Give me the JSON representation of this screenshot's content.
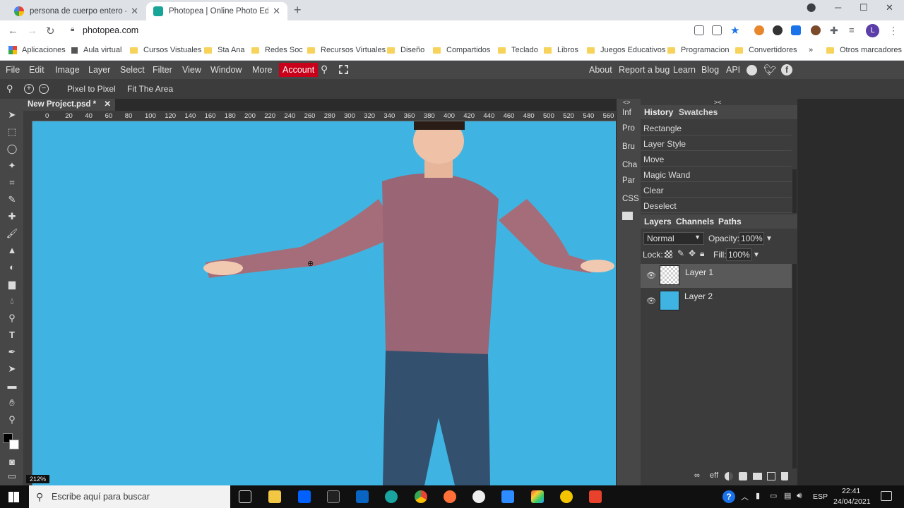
{
  "browser": {
    "tabs": [
      {
        "title": "persona de cuerpo entero - Búsq",
        "active": false
      },
      {
        "title": "Photopea | Online Photo Editor",
        "active": true
      }
    ],
    "url": "photopea.com",
    "avatar_letter": "L",
    "bookmarks": [
      "Aplicaciones",
      "Aula virtual",
      "Cursos Vistuales",
      "Sta Ana",
      "Redes Soc",
      "Recursos Virtuales",
      "Diseño",
      "Compartidos",
      "Teclado",
      "Libros",
      "Juegos Educativos",
      "Programacion",
      "Convertidores"
    ],
    "bookmarks_more": "»",
    "other_bookmarks": "Otros marcadores"
  },
  "menu": {
    "items": [
      "File",
      "Edit",
      "Image",
      "Layer",
      "Select",
      "Filter",
      "View",
      "Window",
      "More"
    ],
    "account": "Account",
    "right_links": [
      "About",
      "Report a bug",
      "Learn",
      "Blog",
      "API"
    ]
  },
  "options": {
    "pixel_to_pixel": "Pixel to Pixel",
    "fit_area": "Fit The Area"
  },
  "document": {
    "tab_title": "New Project.psd *",
    "zoom": "212%",
    "ruler_ticks": [
      "0",
      "20",
      "40",
      "60",
      "80",
      "100",
      "120",
      "140",
      "160",
      "180",
      "200",
      "220",
      "240",
      "260",
      "280",
      "300",
      "320",
      "340",
      "360",
      "380",
      "400",
      "420",
      "440",
      "460",
      "480",
      "500",
      "520",
      "540",
      "560",
      "58"
    ],
    "canvas_color": "#3fb4e2"
  },
  "mini_panel": [
    "Inf",
    "Pro",
    "Bru",
    "Cha",
    "Par",
    "CSS"
  ],
  "history": {
    "tabs": [
      "History",
      "Swatches"
    ],
    "items": [
      "Rectangle",
      "Layer Style",
      "Move",
      "Magic Wand",
      "Clear",
      "Deselect"
    ]
  },
  "layers": {
    "tabs": [
      "Layers",
      "Channels",
      "Paths"
    ],
    "blend_mode": "Normal",
    "opacity_label": "Opacity:",
    "opacity": "100%",
    "lock_label": "Lock:",
    "fill_label": "Fill:",
    "fill": "100%",
    "items": [
      {
        "name": "Layer 1",
        "selected": true
      },
      {
        "name": "Layer 2",
        "selected": false
      }
    ],
    "footer_eff": "eff"
  },
  "taskbar": {
    "search_placeholder": "Escribe aquí para buscar",
    "lang": "ESP",
    "time": "22:41",
    "date": "24/04/2021"
  }
}
